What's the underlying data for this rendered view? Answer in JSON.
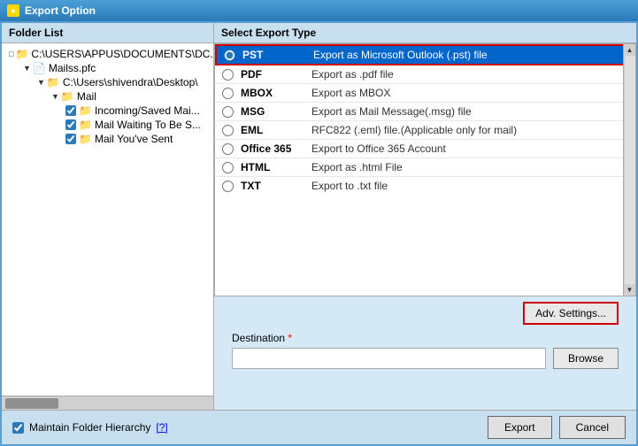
{
  "titleBar": {
    "title": "Export Option",
    "icon": "★"
  },
  "leftPanel": {
    "header": "Folder List",
    "tree": [
      {
        "id": "root",
        "indent": "indent-1",
        "expand": "□",
        "hasCheckbox": false,
        "label": "C:\\USERS\\APPUS\\DOCUMENTS\\DC..."
      },
      {
        "id": "mailss",
        "indent": "indent-2",
        "expand": "▼",
        "hasCheckbox": false,
        "label": "Mailss.pfc"
      },
      {
        "id": "shivendra",
        "indent": "indent-3",
        "expand": "▼",
        "hasCheckbox": false,
        "label": "C:\\Users\\shivendra\\Desktop\\"
      },
      {
        "id": "mail",
        "indent": "indent-4",
        "expand": "▼",
        "hasCheckbox": false,
        "label": "Mail"
      },
      {
        "id": "incoming",
        "indent": "indent-5",
        "expand": "",
        "hasCheckbox": true,
        "checked": true,
        "label": "Incoming/Saved Mai..."
      },
      {
        "id": "mailwaiting",
        "indent": "indent-5",
        "expand": "",
        "hasCheckbox": true,
        "checked": true,
        "label": "Mail Waiting To Be S..."
      },
      {
        "id": "youvesent",
        "indent": "indent-5",
        "expand": "",
        "hasCheckbox": true,
        "checked": true,
        "label": "Mail You've Sent"
      }
    ]
  },
  "rightPanel": {
    "header": "Select Export Type",
    "exportTypes": [
      {
        "id": "pst",
        "label": "PST",
        "description": "Export as Microsoft Outlook (.pst) file",
        "selected": true
      },
      {
        "id": "pdf",
        "label": "PDF",
        "description": "Export as .pdf file",
        "selected": false
      },
      {
        "id": "mbox",
        "label": "MBOX",
        "description": "Export as MBOX",
        "selected": false
      },
      {
        "id": "msg",
        "label": "MSG",
        "description": "Export as Mail Message(.msg) file",
        "selected": false
      },
      {
        "id": "eml",
        "label": "EML",
        "description": "RFC822 (.eml) file.(Applicable only for mail)",
        "selected": false
      },
      {
        "id": "office365",
        "label": "Office 365",
        "description": "Export to Office 365 Account",
        "selected": false
      },
      {
        "id": "html",
        "label": "HTML",
        "description": "Export as .html File",
        "selected": false
      },
      {
        "id": "txt",
        "label": "TXT",
        "description": "Export to .txt file",
        "selected": false
      }
    ],
    "advSettingsBtn": "Adv. Settings...",
    "destinationLabel": "Destination",
    "destinationRequired": "*",
    "browseBtn": "Browse"
  },
  "bottomBar": {
    "maintainLabel": "Maintain Folder Hierarchy",
    "helpLink": "[?]",
    "exportBtn": "Export",
    "cancelBtn": "Cancel"
  }
}
